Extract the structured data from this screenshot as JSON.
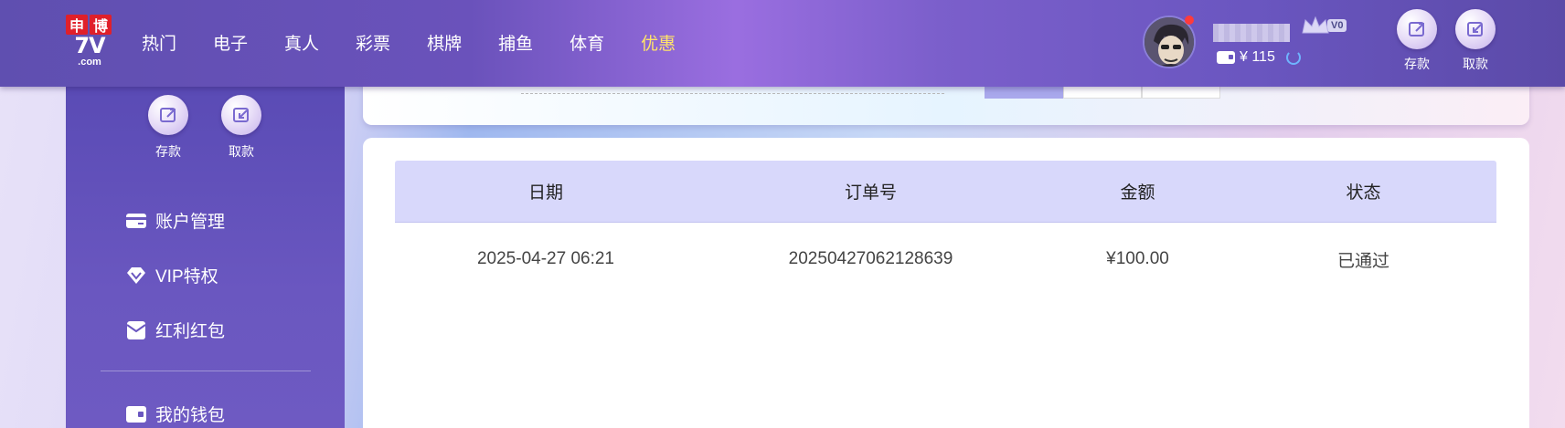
{
  "logo": {
    "top_left": "申",
    "top_right": "博",
    "main": "7V",
    "sub": ".com"
  },
  "nav": [
    {
      "label": "热门"
    },
    {
      "label": "电子"
    },
    {
      "label": "真人"
    },
    {
      "label": "彩票"
    },
    {
      "label": "棋牌"
    },
    {
      "label": "捕鱼"
    },
    {
      "label": "体育"
    },
    {
      "label": "优惠",
      "active": true
    }
  ],
  "user": {
    "balance": "¥ 115",
    "vip_level": "V0"
  },
  "header_actions": {
    "deposit": "存款",
    "withdraw": "取款"
  },
  "sidebar": {
    "deposit": "存款",
    "withdraw": "取款",
    "menu": [
      {
        "label": "账户管理",
        "icon": "card-icon"
      },
      {
        "label": "VIP特权",
        "icon": "diamond-icon"
      },
      {
        "label": "红利红包",
        "icon": "envelope-icon"
      },
      {
        "label": "我的钱包",
        "icon": "wallet-icon"
      }
    ]
  },
  "table": {
    "headers": [
      "日期",
      "订单号",
      "金额",
      "状态"
    ],
    "rows": [
      [
        "2025-04-27 06:21",
        "20250427062128639",
        "¥100.00",
        "已通过"
      ]
    ]
  },
  "colors": {
    "accent": "#ffe36a",
    "header_bg": "#6a52bb",
    "table_head": "#d8d8fb"
  }
}
